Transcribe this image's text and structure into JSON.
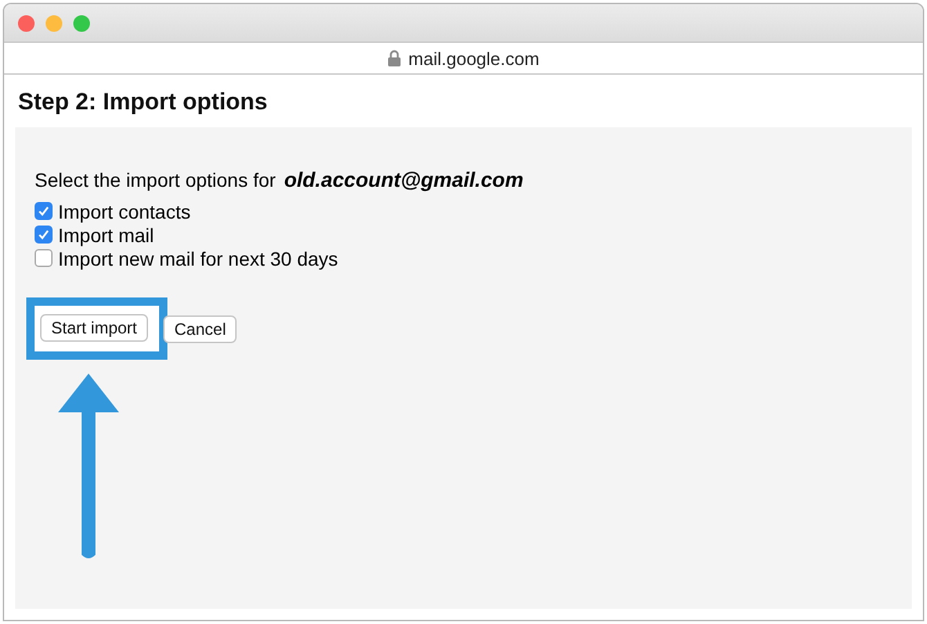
{
  "address_bar": {
    "url": "mail.google.com",
    "secure": true
  },
  "heading": "Step 2: Import options",
  "prompt": {
    "text": "Select the import options for",
    "account": "old.account@gmail.com"
  },
  "options": [
    {
      "label": "Import contacts",
      "checked": true
    },
    {
      "label": "Import mail",
      "checked": true
    },
    {
      "label": "Import new mail for next 30 days",
      "checked": false
    }
  ],
  "buttons": [
    {
      "label": "Start import",
      "highlighted": true
    },
    {
      "label": "Cancel",
      "highlighted": false
    }
  ]
}
